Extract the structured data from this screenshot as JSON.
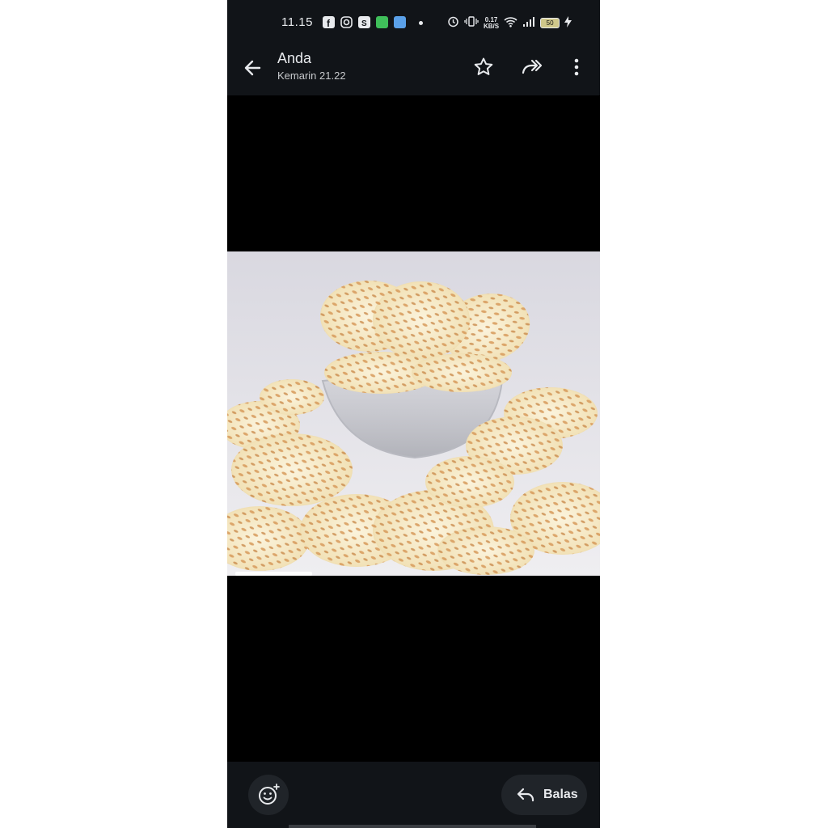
{
  "status_bar": {
    "time": "11.15",
    "app_icons": [
      "facebook-icon",
      "instagram-icon",
      "shopping-bag-icon",
      "green-app-icon",
      "blue-app-icon"
    ],
    "net_speed_value": "0.17",
    "net_speed_unit": "KB/S",
    "battery_level": "50",
    "right_icons": [
      "alarm-icon",
      "vibrate-icon",
      "wifi-icon",
      "signal-icon",
      "charging-icon"
    ]
  },
  "header": {
    "sender": "Anda",
    "timestamp": "Kemarin 21.22",
    "actions": [
      "star-icon",
      "forward-icon",
      "more-vertical-icon"
    ]
  },
  "image": {
    "subject": "tempe chips in glass bowl"
  },
  "footer": {
    "reply_label": "Balas",
    "react_icon": "add-reaction-icon"
  },
  "colors": {
    "bar_bg": "#111418",
    "button_bg": "#202429",
    "text": "#e8eaed"
  }
}
